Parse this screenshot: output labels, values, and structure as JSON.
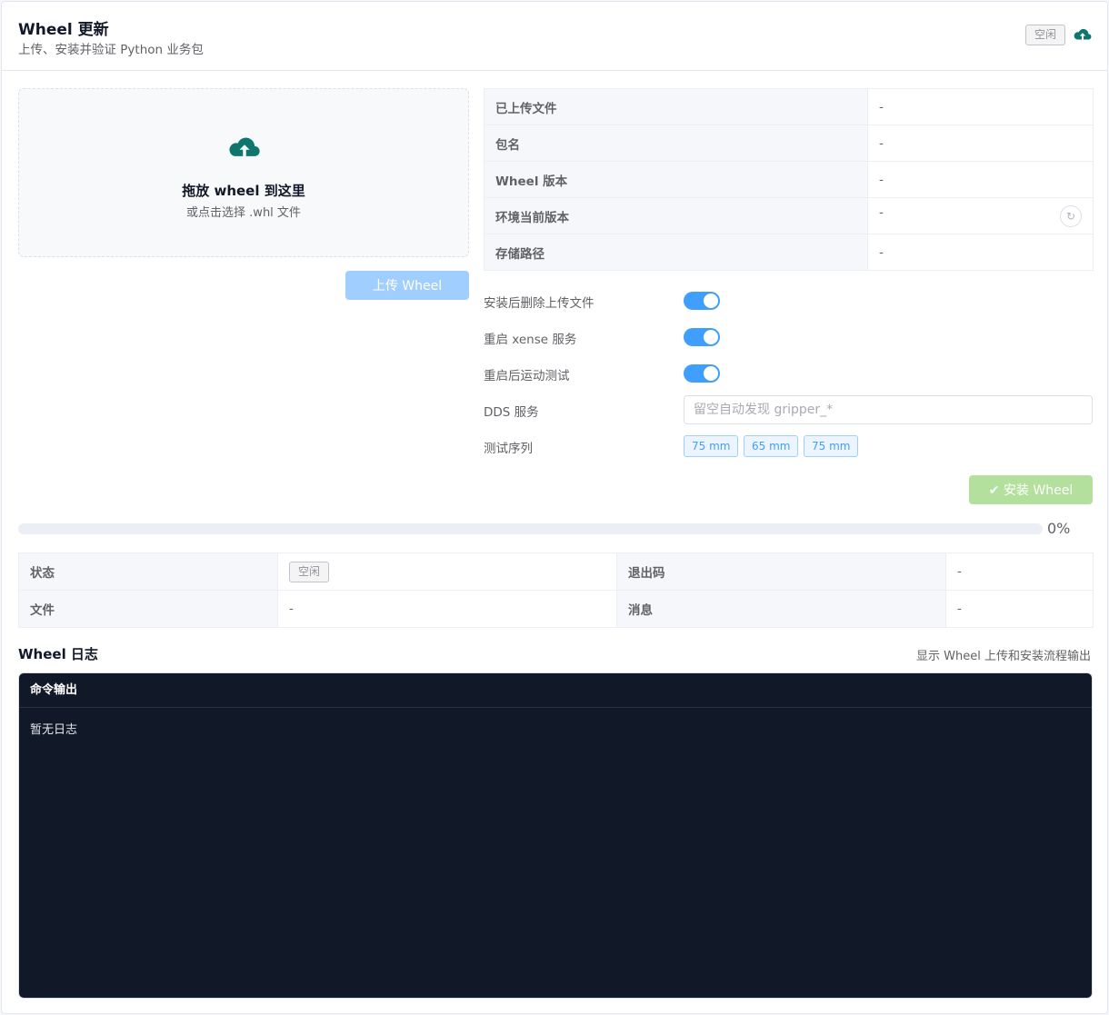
{
  "header": {
    "title": "Wheel 更新",
    "subtitle": "上传、安装并验证 Python 业务包",
    "status_tag": "空闲",
    "upload_icon": "cloud-upload-icon",
    "accent_color": "#0f766e"
  },
  "dropzone": {
    "icon": "cloud-upload-icon",
    "title": "拖放 wheel 到这里",
    "hint": "或点击选择 .whl 文件"
  },
  "upload_button": "上传 Wheel",
  "info": {
    "rows": [
      {
        "label": "已上传文件",
        "value": "-"
      },
      {
        "label": "包名",
        "value": "-"
      },
      {
        "label": "Wheel 版本",
        "value": "-"
      },
      {
        "label": "环境当前版本",
        "value": "-"
      },
      {
        "label": "存储路径",
        "value": "-"
      }
    ],
    "refresh_icon": "refresh-icon"
  },
  "options": {
    "delete_after_install": {
      "label": "安装后删除上传文件",
      "on": true
    },
    "restart_service": {
      "label": "重启 xense 服务",
      "on": true
    },
    "motion_test": {
      "label": "重启后运动测试",
      "on": true
    },
    "dds": {
      "label": "DDS 服务",
      "value": "",
      "placeholder": "留空自动发现 gripper_*"
    },
    "sequence": {
      "label": "测试序列",
      "items": [
        "75 mm",
        "65 mm",
        "75 mm"
      ]
    }
  },
  "install_button": {
    "icon": "check-circle-icon",
    "label": "安装 Wheel"
  },
  "progress": {
    "percent": 0,
    "label": "0%"
  },
  "status": {
    "state_label": "状态",
    "state_value": "空闲",
    "exit_code_label": "退出码",
    "exit_code_value": "-",
    "file_label": "文件",
    "file_value": "-",
    "message_label": "消息",
    "message_value": "-"
  },
  "log": {
    "title": "Wheel 日志",
    "hint": "显示 Wheel 上传和安装流程输出",
    "console_title": "命令输出",
    "content": "暂无日志"
  }
}
